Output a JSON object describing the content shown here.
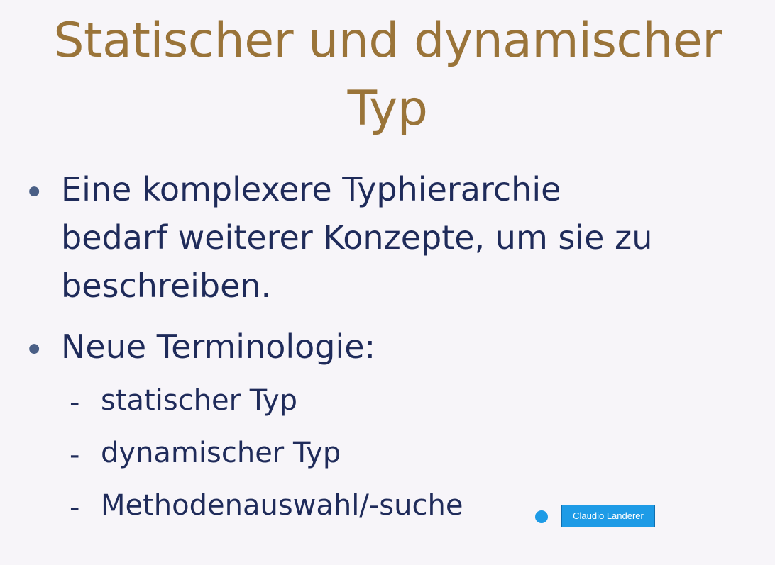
{
  "slide": {
    "title_line1": "Statischer und dynamischer",
    "title_line2": "Typ",
    "bullets": [
      {
        "marker": "•",
        "lines": [
          "Eine komplexere Typhierarchie",
          "bedarf weiterer Konzepte, um sie zu",
          "beschreiben."
        ]
      },
      {
        "marker": "•",
        "lines": [
          "Neue Terminologie:"
        ],
        "subitems": [
          {
            "marker": "-",
            "text": "statischer Typ"
          },
          {
            "marker": "-",
            "text": "dynamischer Typ"
          },
          {
            "marker": "-",
            "text": "Methodenauswahl/-suche"
          }
        ]
      }
    ]
  },
  "presenter": {
    "name": "Claudio Landerer",
    "color": "#1e9be6"
  },
  "colors": {
    "title": "#9a7439",
    "body": "#1f2b5a",
    "background": "#f7f5f9"
  }
}
